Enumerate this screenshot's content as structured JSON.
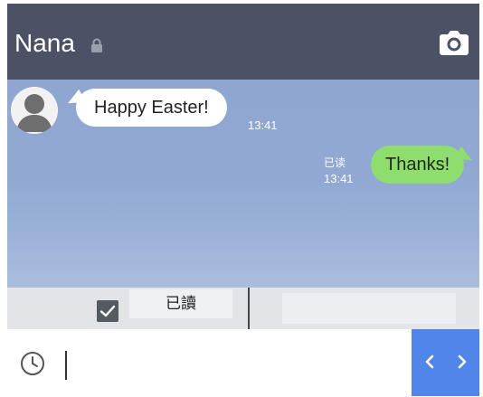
{
  "header": {
    "title": "Nana",
    "icons": [
      "lock-icon",
      "camera-icon"
    ],
    "background": "#4c5266"
  },
  "chat": {
    "messages": [
      {
        "direction": "incoming",
        "text": "Happy Easter!",
        "time": "13:41"
      },
      {
        "direction": "outgoing",
        "text": "Thanks!",
        "status": "已读",
        "time": "13:41"
      }
    ],
    "colors": {
      "incoming_bubble": "#ffffff",
      "outgoing_bubble": "#8fdc6f",
      "background": "#90a8d2"
    }
  },
  "read_bar": {
    "checkbox_checked": true,
    "label": "已讀"
  },
  "composer": {
    "input_value": "",
    "icons": [
      "clock-icon",
      "chevron-left-icon",
      "chevron-right-icon"
    ],
    "nav_color": "#4f86e8"
  }
}
